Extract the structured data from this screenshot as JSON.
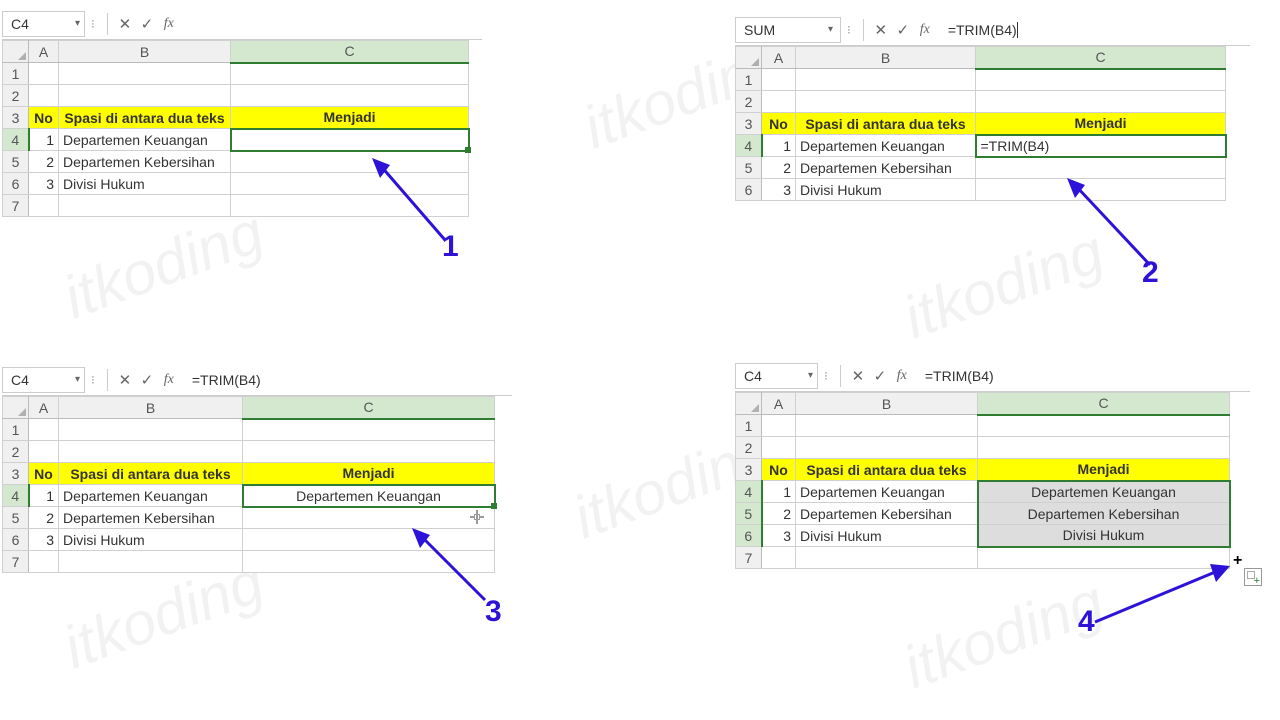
{
  "panels": [
    {
      "nameBox": "C4",
      "formula": "",
      "selectedCol": "C",
      "selectedRow": "4",
      "colWidths": {
        "A": 30,
        "B": 172,
        "C": 238
      },
      "headers": {
        "no": "No",
        "spasi": "Spasi di antara dua teks",
        "menjadi": "Menjadi"
      },
      "rows": [
        {
          "no": "1",
          "spasi": "Departemen   Keuangan",
          "menjadi": ""
        },
        {
          "no": "2",
          "spasi": "Departemen   Kebersihan",
          "menjadi": ""
        },
        {
          "no": "3",
          "spasi": "Divisi      Hukum",
          "menjadi": ""
        }
      ],
      "step": "1"
    },
    {
      "nameBox": "SUM",
      "formula": "=TRIM(B4)",
      "formulaCell": "=TRIM(B4)",
      "selectedCol": "C",
      "selectedRow": "4",
      "colWidths": {
        "A": 34,
        "B": 180,
        "C": 250
      },
      "headers": {
        "no": "No",
        "spasi": "Spasi di antara dua teks",
        "menjadi": "Menjadi"
      },
      "rows": [
        {
          "no": "1",
          "spasi": "Departemen   Keuangan",
          "menjadi": "=TRIM(B4)"
        },
        {
          "no": "2",
          "spasi": "Departemen   Kebersihan",
          "menjadi": ""
        },
        {
          "no": "3",
          "spasi": "Divisi      Hukum",
          "menjadi": ""
        }
      ],
      "step": "2"
    },
    {
      "nameBox": "C4",
      "formula": "=TRIM(B4)",
      "selectedCol": "C",
      "selectedRow": "4",
      "colWidths": {
        "A": 30,
        "B": 184,
        "C": 252
      },
      "headers": {
        "no": "No",
        "spasi": "Spasi di antara dua teks",
        "menjadi": "Menjadi"
      },
      "rows": [
        {
          "no": "1",
          "spasi": "Departemen   Keuangan",
          "menjadi": "Departemen Keuangan"
        },
        {
          "no": "2",
          "spasi": "Departemen   Kebersihan",
          "menjadi": ""
        },
        {
          "no": "3",
          "spasi": "Divisi      Hukum",
          "menjadi": ""
        }
      ],
      "step": "3"
    },
    {
      "nameBox": "C4",
      "formula": "=TRIM(B4)",
      "selectedCol": "C",
      "selectedRow": "4",
      "colWidths": {
        "A": 34,
        "B": 182,
        "C": 252
      },
      "headers": {
        "no": "No",
        "spasi": "Spasi di antara dua teks",
        "menjadi": "Menjadi"
      },
      "rows": [
        {
          "no": "1",
          "spasi": "Departemen   Keuangan",
          "menjadi": "Departemen Keuangan"
        },
        {
          "no": "2",
          "spasi": "Departemen   Kebersihan",
          "menjadi": "Departemen Kebersihan"
        },
        {
          "no": "3",
          "spasi": "Divisi      Hukum",
          "menjadi": "Divisi Hukum"
        }
      ],
      "step": "4"
    }
  ]
}
